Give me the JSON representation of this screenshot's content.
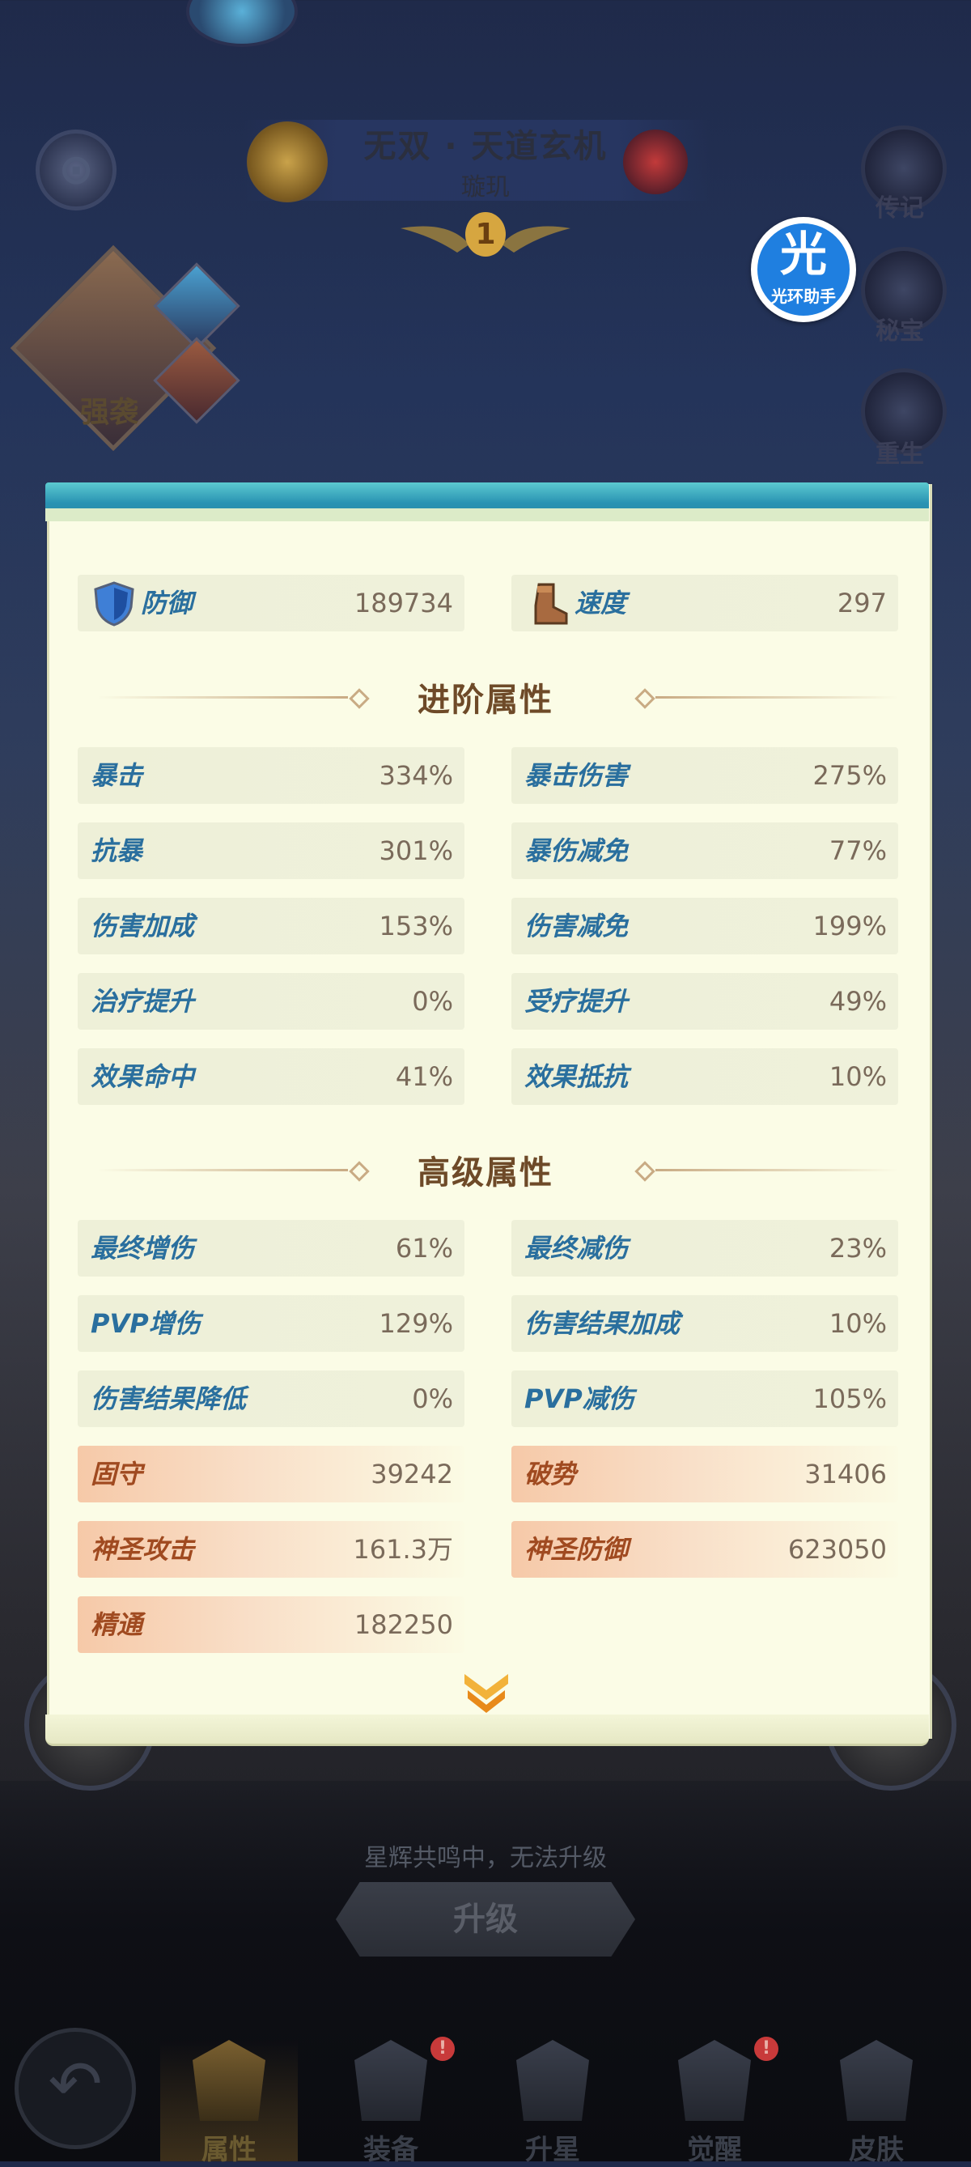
{
  "hero": {
    "title": "无双 · 天道玄机",
    "name": "璇玑",
    "rank": "1",
    "team_tag": "强袭"
  },
  "side_menu": [
    {
      "label": "传记",
      "icon": "book-icon"
    },
    {
      "label": "秘宝",
      "icon": "gem-icon"
    },
    {
      "label": "重生",
      "icon": "rebirth-icon"
    }
  ],
  "overlay": {
    "glyph": "光",
    "label": "光环助手"
  },
  "basic_stats": [
    {
      "name": "防御",
      "value": "189734",
      "icon": "shield-icon"
    },
    {
      "name": "速度",
      "value": "297",
      "icon": "boot-icon"
    }
  ],
  "advanced": {
    "title": "进阶属性",
    "stats": [
      {
        "name": "暴击",
        "value": "334%"
      },
      {
        "name": "暴击伤害",
        "value": "275%"
      },
      {
        "name": "抗暴",
        "value": "301%"
      },
      {
        "name": "暴伤减免",
        "value": "77%"
      },
      {
        "name": "伤害加成",
        "value": "153%"
      },
      {
        "name": "伤害减免",
        "value": "199%"
      },
      {
        "name": "治疗提升",
        "value": "0%"
      },
      {
        "name": "受疗提升",
        "value": "49%"
      },
      {
        "name": "效果命中",
        "value": "41%"
      },
      {
        "name": "效果抵抗",
        "value": "10%"
      }
    ]
  },
  "senior": {
    "title": "高级属性",
    "stats": [
      {
        "name": "最终增伤",
        "value": "61%"
      },
      {
        "name": "最终减伤",
        "value": "23%"
      },
      {
        "name": "PVP增伤",
        "value": "129%"
      },
      {
        "name": "伤害结果加成",
        "value": "10%"
      },
      {
        "name": "伤害结果降低",
        "value": "0%"
      },
      {
        "name": "PVP减伤",
        "value": "105%"
      },
      {
        "name": "固守",
        "value": "39242"
      },
      {
        "name": "破势",
        "value": "31406"
      },
      {
        "name": "神圣攻击",
        "value": "161.3万"
      },
      {
        "name": "神圣防御",
        "value": "623050"
      },
      {
        "name": "精通",
        "value": "182250"
      }
    ]
  },
  "footer": {
    "note": "星辉共鸣中，无法升级",
    "upgrade_label": "升级"
  },
  "tabs": [
    {
      "label": "属性",
      "icon": "helmet-icon",
      "active": true,
      "badge": false
    },
    {
      "label": "装备",
      "icon": "sword-icon",
      "active": false,
      "badge": true
    },
    {
      "label": "升星",
      "icon": "star-icon",
      "active": false,
      "badge": false
    },
    {
      "label": "觉醒",
      "icon": "awaken-icon",
      "active": false,
      "badge": true
    },
    {
      "label": "皮肤",
      "icon": "armor-icon",
      "active": false,
      "badge": false
    }
  ],
  "badge_mark": "!",
  "colors": {
    "panel_bg": "#fbfce6",
    "stat_name_blue": "#2a6f9e",
    "stat_name_orange": "#a04a20",
    "section_title": "#6e4a28",
    "panel_top": "#2a93b3"
  }
}
